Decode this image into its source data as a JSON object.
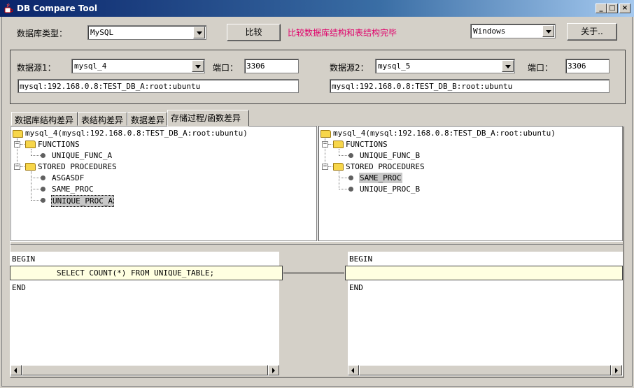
{
  "window": {
    "title": "DB Compare Tool"
  },
  "toolbar": {
    "db_type_label": "数据库类型：",
    "db_type_value": "MySQL",
    "compare_button": "比较",
    "status_message": "比较数据库结构和表结构完毕",
    "status_color": "#e0006a",
    "lookandfeel_value": "Windows",
    "about_button": "关于.."
  },
  "source1": {
    "label": "数据源1：",
    "value": "mysql_4",
    "port_label": "端口：",
    "port": "3306",
    "connection": "mysql:192.168.0.8:TEST_DB_A:root:ubuntu"
  },
  "source2": {
    "label": "数据源2：",
    "value": "mysql_5",
    "port_label": "端口：",
    "port": "3306",
    "connection": "mysql:192.168.0.8:TEST_DB_B:root:ubuntu"
  },
  "tabs": [
    {
      "label": "数据库结构差异"
    },
    {
      "label": "表结构差异"
    },
    {
      "label": "数据差异"
    },
    {
      "label": "存储过程/函数差异"
    }
  ],
  "left_tree": {
    "root": "mysql_4(mysql:192.168.0.8:TEST_DB_A:root:ubuntu)",
    "functions_label": "FUNCTIONS",
    "functions": [
      "UNIQUE_FUNC_A"
    ],
    "procedures_label": "STORED PROCEDURES",
    "procedures": [
      "ASGASDF",
      "SAME_PROC",
      "UNIQUE_PROC_A"
    ]
  },
  "right_tree": {
    "root": "mysql_4(mysql:192.168.0.8:TEST_DB_A:root:ubuntu)",
    "functions_label": "FUNCTIONS",
    "functions": [
      "UNIQUE_FUNC_B"
    ],
    "procedures_label": "STORED PROCEDURES",
    "procedures": [
      "SAME_PROC",
      "UNIQUE_PROC_B"
    ]
  },
  "left_code": {
    "line1": "BEGIN",
    "line2": "SELECT COUNT(*) FROM UNIQUE_TABLE;",
    "line3": "END"
  },
  "right_code": {
    "line1": "BEGIN",
    "line2": "",
    "line3": "END"
  }
}
